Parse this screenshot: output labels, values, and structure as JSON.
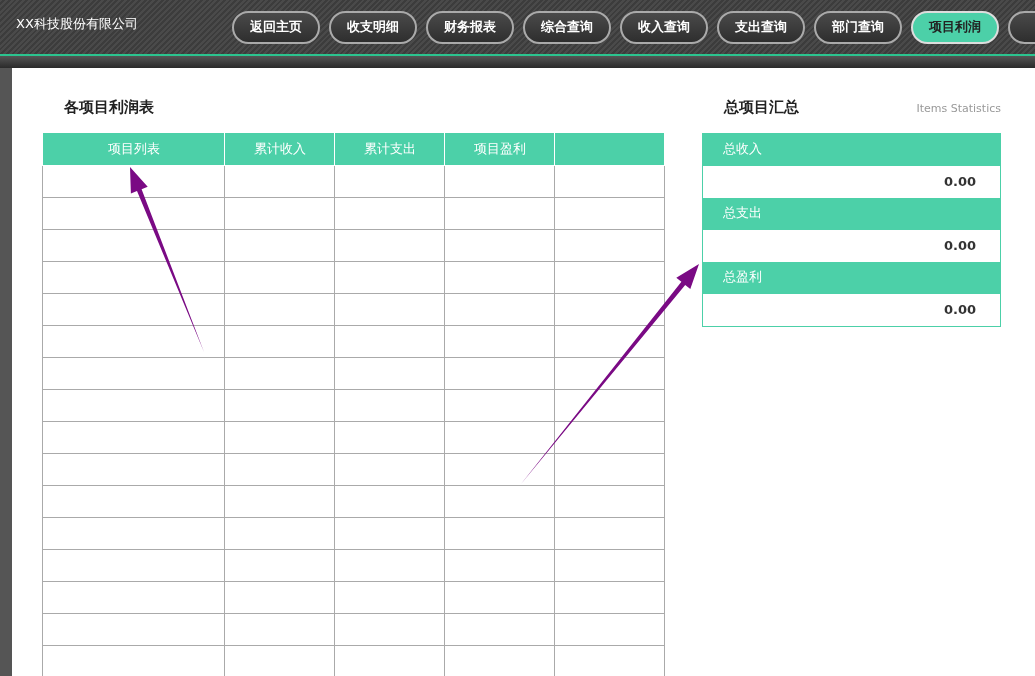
{
  "header": {
    "company": "XX科技股份有限公司"
  },
  "nav": [
    {
      "label": "返回主页",
      "selected": false
    },
    {
      "label": "收支明细",
      "selected": false
    },
    {
      "label": "财务报表",
      "selected": false
    },
    {
      "label": "综合查询",
      "selected": false
    },
    {
      "label": "收入查询",
      "selected": false
    },
    {
      "label": "支出查询",
      "selected": false
    },
    {
      "label": "部门查询",
      "selected": false
    },
    {
      "label": "项目利润",
      "selected": true
    },
    {
      "selected": false
    }
  ],
  "profit_table": {
    "title": "各项目利润表",
    "columns": [
      {
        "label": "项目列表"
      },
      {
        "label": "累计收入"
      },
      {
        "label": "累计支出"
      },
      {
        "label": "项目盈利"
      },
      {}
    ]
  },
  "summary": {
    "title": "总项目汇总",
    "subtitle": "Items Statistics",
    "items": [
      {
        "label": "总收入",
        "value": "0.00"
      },
      {
        "label": "总支出",
        "value": "0.00"
      },
      {
        "label": "总盈利",
        "value": "0.00"
      }
    ]
  }
}
